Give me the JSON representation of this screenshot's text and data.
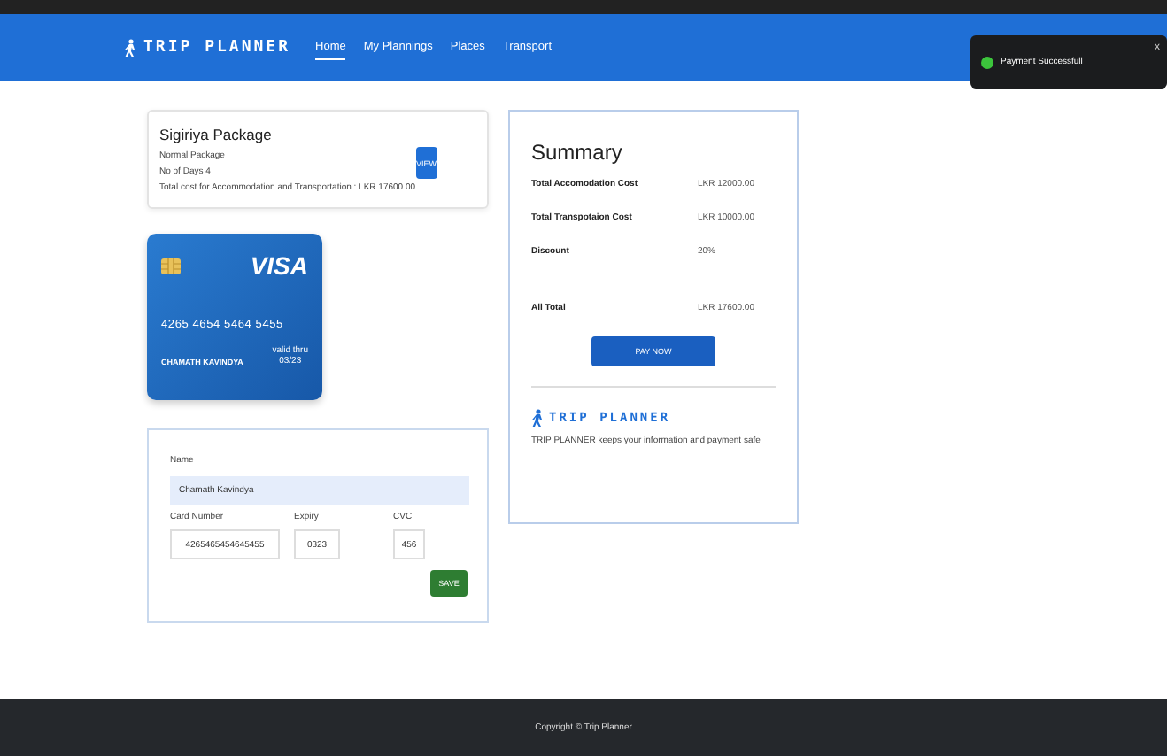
{
  "nav": {
    "brand": "TRIP PLANNER",
    "links": [
      {
        "label": "Home",
        "selected": true
      },
      {
        "label": "My Plannings",
        "selected": false
      },
      {
        "label": "Places",
        "selected": false
      },
      {
        "label": "Transport",
        "selected": false
      }
    ]
  },
  "toast": {
    "message": "Payment Successfull",
    "close": "x"
  },
  "package": {
    "title": "Sigiriya Package",
    "type": "Normal Package",
    "days": "No of Days 4",
    "cost": "Total cost for Accommodation and Transportation : LKR 17600.00",
    "button": "VIEW"
  },
  "card": {
    "brand": "VISA",
    "number": "4265 4654 5464 5455",
    "holder": "CHAMATH KAVINDYA",
    "valid_label": "valid thru",
    "expiry": "03/23"
  },
  "form": {
    "name_label": "Name",
    "name_value": "Chamath Kavindya",
    "number_label": "Card Number",
    "number_value": "4265465454645455",
    "expiry_label": "Expiry",
    "expiry_value": "0323",
    "cvc_label": "CVC",
    "cvc_value": "456",
    "button": "SAVE"
  },
  "summary": {
    "title": "Summary",
    "rows": [
      {
        "label": "Total Accomodation Cost",
        "value": "LKR 12000.00"
      },
      {
        "label": "Total Transpotaion Cost",
        "value": "LKR 10000.00"
      },
      {
        "label": "Discount",
        "value": "20%"
      },
      {
        "label": "All Total",
        "value": "LKR 17600.00"
      }
    ],
    "button": "PAY NOW",
    "brand": "TRIP PLANNER",
    "note": "TRIP PLANNER keeps your information and payment safe"
  },
  "footer": "Copyright © Trip Planner"
}
